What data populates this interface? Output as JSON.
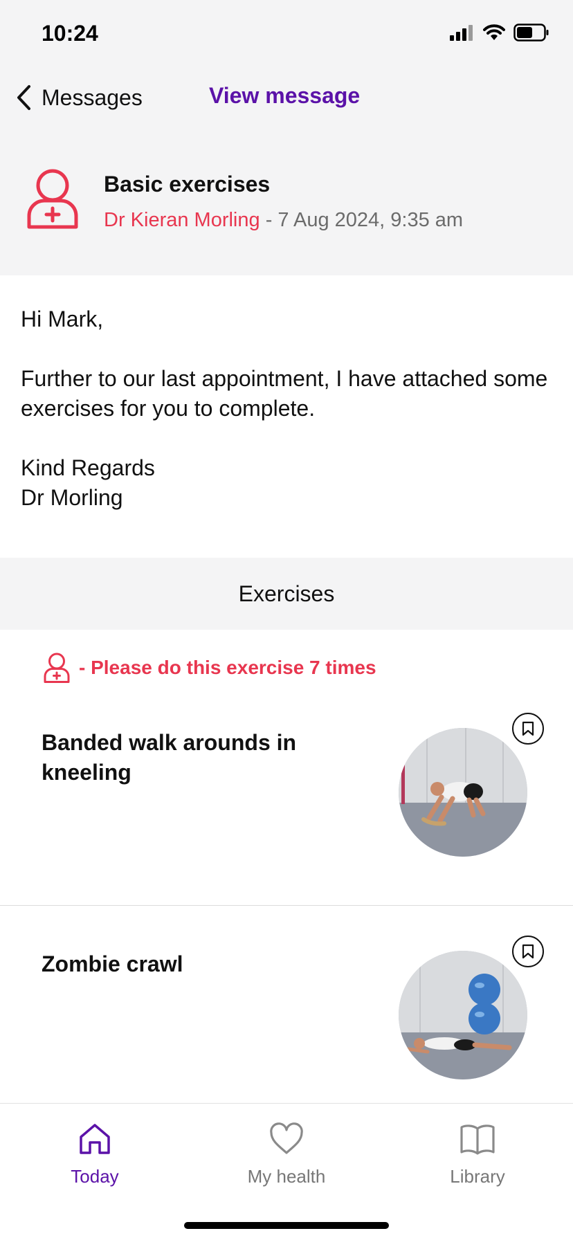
{
  "status_bar": {
    "time": "10:24"
  },
  "nav": {
    "back_label": "Messages",
    "title": "View message"
  },
  "message": {
    "subject": "Basic exercises",
    "sender": "Dr Kieran Morling",
    "separator": " - ",
    "date": "7 Aug 2024, 9:35 am",
    "body": {
      "greeting": "Hi Mark,",
      "paragraph": "Further to our last appointment, I have attached some exercises for you to complete.",
      "signoff": "Kind Regards",
      "signature": "Dr Morling"
    }
  },
  "exercises_section": {
    "title": "Exercises",
    "instruction": "- Please do this exercise 7 times",
    "items": [
      {
        "title": "Banded walk arounds in kneeling"
      },
      {
        "title": "Zombie crawl"
      }
    ]
  },
  "tabs": [
    {
      "label": "Today",
      "icon": "home-icon",
      "active": true
    },
    {
      "label": "My health",
      "icon": "heart-icon",
      "active": false
    },
    {
      "label": "Library",
      "icon": "book-icon",
      "active": false
    }
  ],
  "colors": {
    "accent_purple": "#5b12a8",
    "accent_red": "#e8364f",
    "header_bg": "#f4f4f5"
  }
}
